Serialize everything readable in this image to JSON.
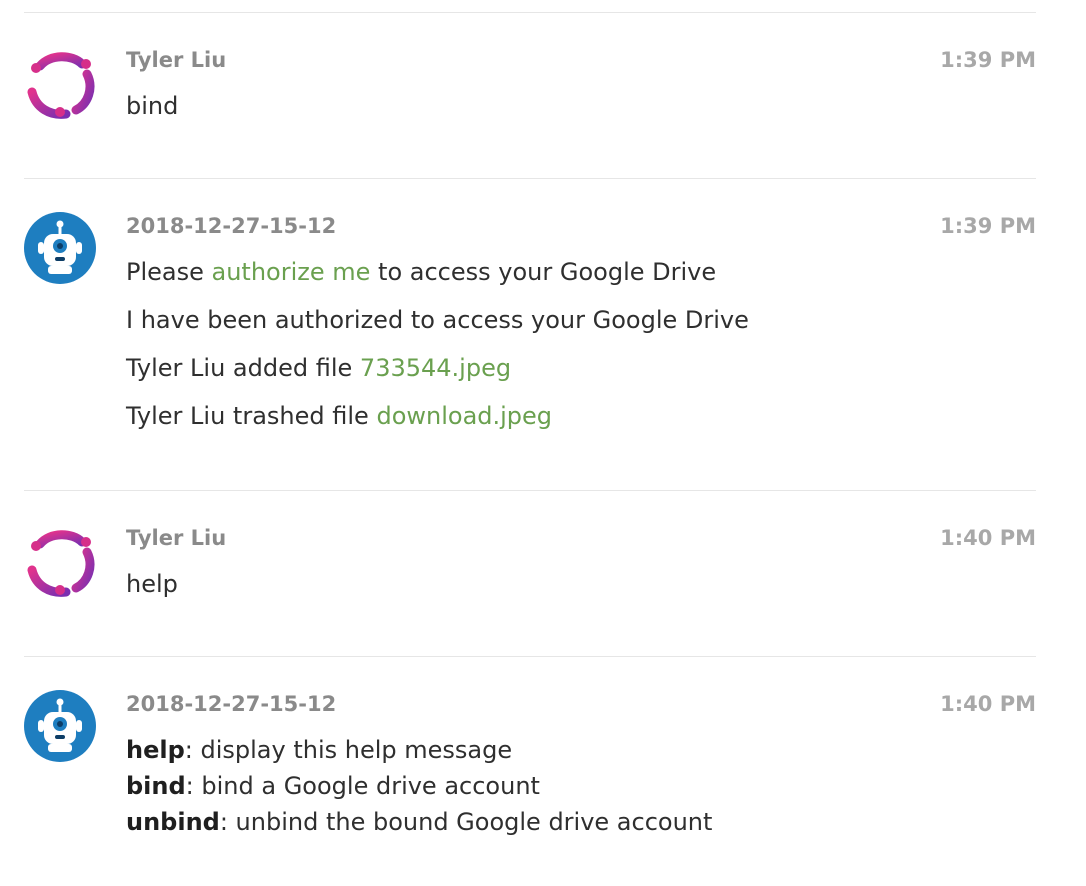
{
  "messages": [
    {
      "sender": "Tyler Liu",
      "time": "1:39 PM",
      "lines": [
        "bind"
      ]
    },
    {
      "sender": "2018-12-27-15-12",
      "time": "1:39 PM",
      "lines": [
        {
          "before": "Please ",
          "link": "authorize me",
          "after": " to access your Google Drive"
        },
        {
          "text": "I have been authorized to access your Google Drive"
        },
        {
          "before": "Tyler Liu added file ",
          "link": "733544.jpeg"
        },
        {
          "before": "Tyler Liu trashed file ",
          "link": "download.jpeg"
        }
      ]
    },
    {
      "sender": "Tyler Liu",
      "time": "1:40 PM",
      "lines": [
        "help"
      ]
    },
    {
      "sender": "2018-12-27-15-12",
      "time": "1:40 PM",
      "help": [
        {
          "cmd": "help",
          "desc": ": display this help message"
        },
        {
          "cmd": "bind",
          "desc": ": bind a Google drive account"
        },
        {
          "cmd": "unbind",
          "desc": ": unbind the bound Google drive account"
        }
      ]
    }
  ],
  "colors": {
    "link": "#6aa04f",
    "user_avatar_pink": "#d62f8a",
    "user_avatar_purple": "#7b2fb0",
    "bot_avatar_blue": "#1e7ec0"
  },
  "icons": {
    "user_avatar": "magenta-ring-avatar-icon",
    "bot_avatar": "blue-robot-avatar-icon"
  }
}
